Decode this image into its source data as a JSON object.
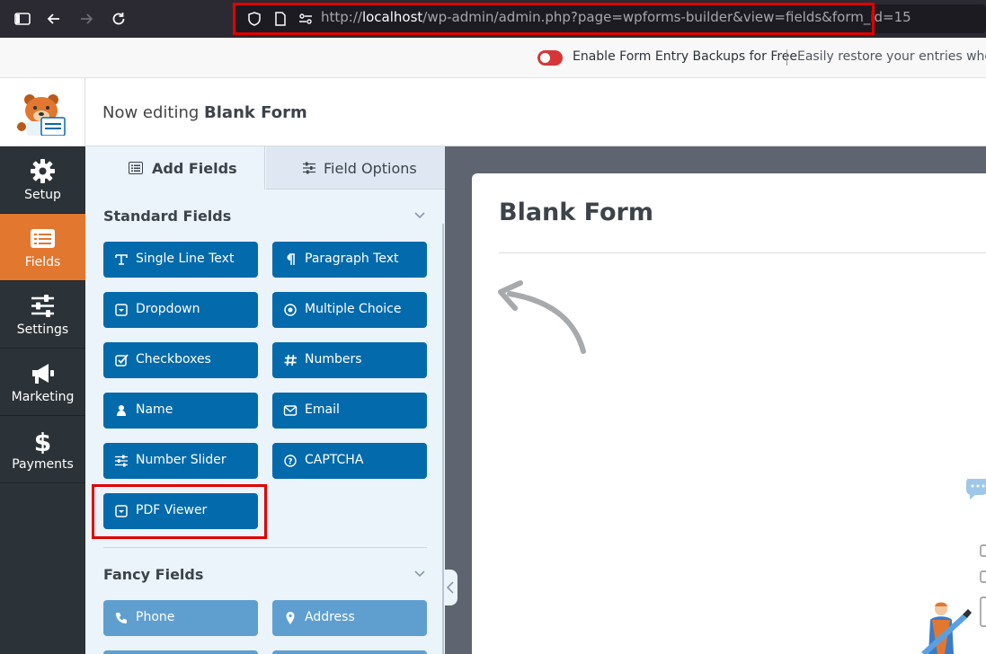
{
  "browser": {
    "url_scheme": "http://",
    "url_host": "localhost",
    "url_path": "/wp-admin/admin.php?page=wpforms-builder&view=fields&form_id=15"
  },
  "notice": {
    "main": "Enable Form Entry Backups for Free",
    "sub": "Easily restore your entries when yo"
  },
  "header": {
    "prefix": "Now editing ",
    "form_name": "Blank Form"
  },
  "nav": {
    "items": [
      {
        "label": "Setup",
        "icon": "gear-icon"
      },
      {
        "label": "Fields",
        "icon": "list-icon",
        "active": true
      },
      {
        "label": "Settings",
        "icon": "sliders-icon"
      },
      {
        "label": "Marketing",
        "icon": "megaphone-icon"
      },
      {
        "label": "Payments",
        "icon": "dollar-icon"
      }
    ]
  },
  "tabs": {
    "add_fields": "Add Fields",
    "field_options": "Field Options"
  },
  "standard": {
    "title": "Standard Fields",
    "fields": [
      {
        "label": "Single Line Text",
        "icon": "text-icon"
      },
      {
        "label": "Paragraph Text",
        "icon": "paragraph-icon"
      },
      {
        "label": "Dropdown",
        "icon": "dropdown-icon"
      },
      {
        "label": "Multiple Choice",
        "icon": "radio-icon"
      },
      {
        "label": "Checkboxes",
        "icon": "checkbox-icon"
      },
      {
        "label": "Numbers",
        "icon": "hash-icon"
      },
      {
        "label": "Name",
        "icon": "user-icon"
      },
      {
        "label": "Email",
        "icon": "envelope-icon"
      },
      {
        "label": "Number Slider",
        "icon": "sliders-icon"
      },
      {
        "label": "CAPTCHA",
        "icon": "question-icon"
      },
      {
        "label": "PDF Viewer",
        "icon": "dropdown-icon"
      }
    ]
  },
  "fancy": {
    "title": "Fancy Fields",
    "fields": [
      {
        "label": "Phone",
        "icon": "phone-icon"
      },
      {
        "label": "Address",
        "icon": "map-pin-icon"
      }
    ]
  },
  "preview": {
    "form_title": "Blank Form"
  },
  "colors": {
    "accent": "#e27730",
    "button": "#036aab",
    "fancy_button": "#5f9fd0",
    "highlight": "#e00000"
  }
}
